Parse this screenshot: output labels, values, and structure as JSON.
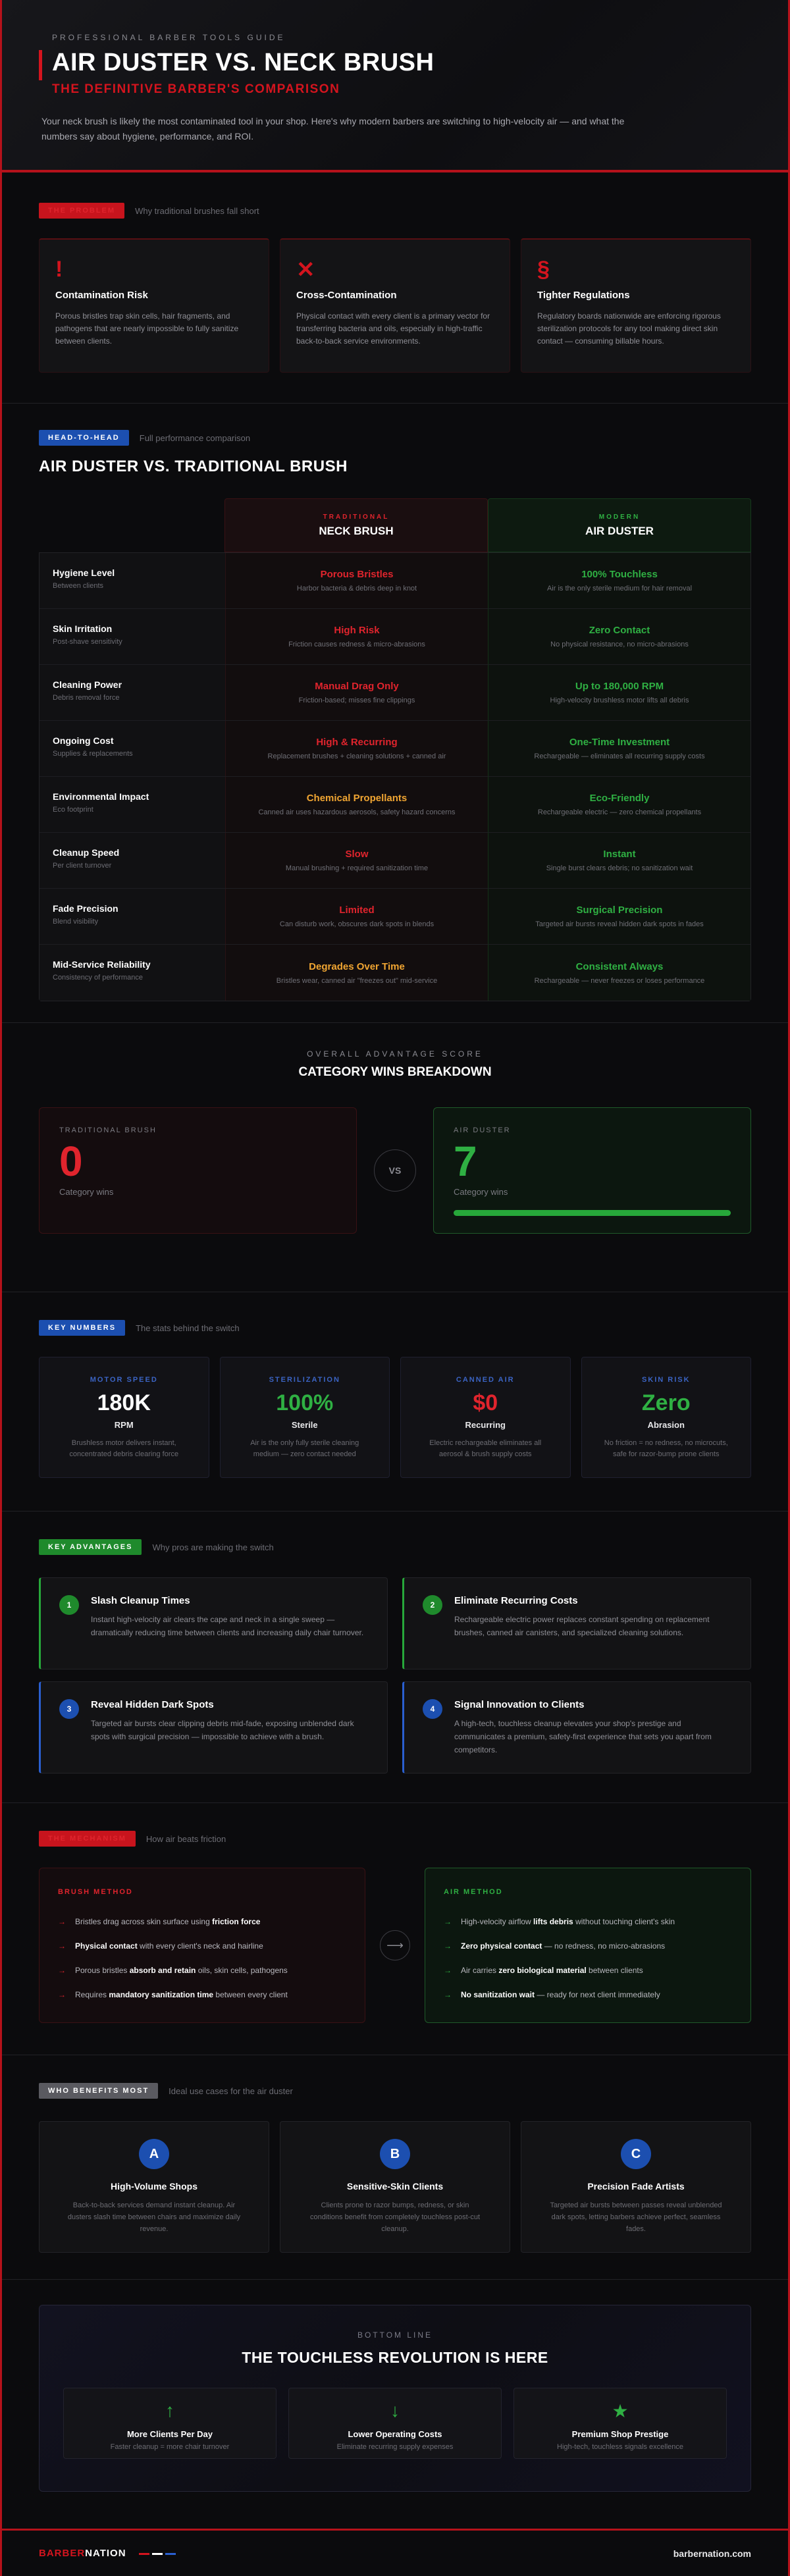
{
  "header": {
    "eyebrow": "PROFESSIONAL BARBER TOOLS GUIDE",
    "title": "AIR DUSTER VS. NECK BRUSH",
    "subtitle": "THE DEFINITIVE BARBER'S COMPARISON",
    "intro": "Your neck brush is likely the most contaminated tool in your shop. Here's why modern barbers are switching to high-velocity air — and what the numbers say about hygiene, performance, and ROI."
  },
  "problem": {
    "tag": "THE PROBLEM",
    "note": "Why traditional brushes fall short",
    "cards": [
      {
        "icon": "!",
        "title": "Contamination Risk",
        "text": "Porous bristles trap skin cells, hair fragments, and pathogens that are nearly impossible to fully sanitize between clients."
      },
      {
        "icon": "✕",
        "title": "Cross-Contamination",
        "text": "Physical contact with every client is a primary vector for transferring bacteria and oils, especially in high-traffic back-to-back service environments."
      },
      {
        "icon": "§",
        "title": "Tighter Regulations",
        "text": "Regulatory boards nationwide are enforcing rigorous sterilization protocols for any tool making direct skin contact — consuming billable hours."
      }
    ]
  },
  "compare": {
    "tag": "HEAD-TO-HEAD",
    "note": "Full performance comparison",
    "title": "AIR DUSTER VS. TRADITIONAL BRUSH",
    "trad_kicker": "TRADITIONAL",
    "trad_name": "NECK BRUSH",
    "air_kicker": "MODERN",
    "air_name": "AIR DUSTER",
    "rows": [
      {
        "label": "Hygiene Level",
        "sub": "Between clients",
        "t": "Porous Bristles",
        "td": "Harbor bacteria & debris deep in knot",
        "tc": "red",
        "a": "100% Touchless",
        "ad": "Air is the only sterile medium for hair removal"
      },
      {
        "label": "Skin Irritation",
        "sub": "Post-shave sensitivity",
        "t": "High Risk",
        "td": "Friction causes redness & micro-abrasions",
        "tc": "red",
        "a": "Zero Contact",
        "ad": "No physical resistance, no micro-abrasions"
      },
      {
        "label": "Cleaning Power",
        "sub": "Debris removal force",
        "t": "Manual Drag Only",
        "td": "Friction-based; misses fine clippings",
        "tc": "red",
        "a": "Up to 180,000 RPM",
        "ad": "High-velocity brushless motor lifts all debris"
      },
      {
        "label": "Ongoing Cost",
        "sub": "Supplies & replacements",
        "t": "High & Recurring",
        "td": "Replacement brushes + cleaning solutions + canned air",
        "tc": "red",
        "a": "One-Time Investment",
        "ad": "Rechargeable — eliminates all recurring supply costs"
      },
      {
        "label": "Environmental Impact",
        "sub": "Eco footprint",
        "t": "Chemical Propellants",
        "td": "Canned air uses hazardous aerosols, safety hazard concerns",
        "tc": "org",
        "a": "Eco-Friendly",
        "ad": "Rechargeable electric — zero chemical propellants"
      },
      {
        "label": "Cleanup Speed",
        "sub": "Per client turnover",
        "t": "Slow",
        "td": "Manual brushing + required sanitization time",
        "tc": "red",
        "a": "Instant",
        "ad": "Single burst clears debris; no sanitization wait"
      },
      {
        "label": "Fade Precision",
        "sub": "Blend visibility",
        "t": "Limited",
        "td": "Can disturb work, obscures dark spots in blends",
        "tc": "red",
        "a": "Surgical Precision",
        "ad": "Targeted air bursts reveal hidden dark spots in fades"
      },
      {
        "label": "Mid-Service Reliability",
        "sub": "Consistency of performance",
        "t": "Degrades Over Time",
        "td": "Bristles wear, canned air \"freezes out\" mid-service",
        "tc": "org",
        "a": "Consistent Always",
        "ad": "Rechargeable — never freezes or loses performance"
      }
    ]
  },
  "score": {
    "eyebrow": "OVERALL ADVANTAGE SCORE",
    "title": "CATEGORY WINS BREAKDOWN",
    "trad_label": "TRADITIONAL BRUSH",
    "trad_value": "0",
    "trad_caption": "Category wins",
    "vs": "VS",
    "air_label": "AIR DUSTER",
    "air_value": "7",
    "air_caption": "Category wins",
    "air_fill": 1.0
  },
  "numbers": {
    "tag": "KEY NUMBERS",
    "note": "The stats behind the switch",
    "stats": [
      {
        "k": "MOTOR SPEED",
        "v": "180K",
        "u": "RPM",
        "d": "Brushless motor delivers instant, concentrated debris clearing force",
        "color": "#ffffff"
      },
      {
        "k": "STERILIZATION",
        "v": "100%",
        "u": "Sterile",
        "d": "Air is the only fully sterile cleaning medium — zero contact needed",
        "color": "#2fb043"
      },
      {
        "k": "CANNED AIR",
        "v": "$0",
        "u": "Recurring",
        "d": "Electric rechargeable eliminates all aerosol & brush supply costs",
        "color": "#e0242d"
      },
      {
        "k": "SKIN RISK",
        "v": "Zero",
        "u": "Abrasion",
        "d": "No friction = no redness, no microcuts, safe for razor-bump prone clients",
        "color": "#2fb043"
      }
    ]
  },
  "advantages": {
    "tag": "KEY ADVANTAGES",
    "note": "Why pros are making the switch",
    "items": [
      {
        "n": "1",
        "title": "Slash Cleanup Times",
        "text": "Instant high-velocity air clears the cape and neck in a single sweep — dramatically reducing time between clients and increasing daily chair turnover."
      },
      {
        "n": "2",
        "title": "Eliminate Recurring Costs",
        "text": "Rechargeable electric power replaces constant spending on replacement brushes, canned air canisters, and specialized cleaning solutions."
      },
      {
        "n": "3",
        "title": "Reveal Hidden Dark Spots",
        "text": "Targeted air bursts clear clipping debris mid-fade, exposing unblended dark spots with surgical precision — impossible to achieve with a brush."
      },
      {
        "n": "4",
        "title": "Signal Innovation to Clients",
        "text": "A high-tech, touchless cleanup elevates your shop's prestige and communicates a premium, safety-first experience that sets you apart from competitors."
      }
    ]
  },
  "mechanism": {
    "tag": "THE MECHANISM",
    "note": "How air beats friction",
    "brush_label": "BRUSH METHOD",
    "brush_items": [
      {
        "pre": "Bristles drag across skin surface using ",
        "b": "friction force",
        "post": ""
      },
      {
        "pre": "",
        "b": "Physical contact",
        "post": " with every client's neck and hairline"
      },
      {
        "pre": "Porous bristles ",
        "b": "absorb and retain",
        "post": " oils, skin cells, pathogens"
      },
      {
        "pre": "Requires ",
        "b": "mandatory sanitization time",
        "post": " between every client"
      }
    ],
    "air_label": "AIR METHOD",
    "air_items": [
      {
        "pre": "High-velocity airflow ",
        "b": "lifts debris",
        "post": " without touching client's skin"
      },
      {
        "pre": "",
        "b": "Zero physical contact",
        "post": " — no redness, no micro-abrasions"
      },
      {
        "pre": "Air carries ",
        "b": "zero biological material",
        "post": " between clients"
      },
      {
        "pre": "",
        "b": "No sanitization wait",
        "post": " — ready for next client immediately"
      }
    ]
  },
  "who": {
    "tag": "WHO BENEFITS MOST",
    "note": "Ideal use cases for the air duster",
    "items": [
      {
        "l": "A",
        "title": "High-Volume Shops",
        "text": "Back-to-back services demand instant cleanup. Air dusters slash time between chairs and maximize daily revenue."
      },
      {
        "l": "B",
        "title": "Sensitive-Skin Clients",
        "text": "Clients prone to razor bumps, redness, or skin conditions benefit from completely touchless post-cut cleanup."
      },
      {
        "l": "C",
        "title": "Precision Fade Artists",
        "text": "Targeted air bursts between passes reveal unblended dark spots, letting barbers achieve perfect, seamless fades."
      }
    ]
  },
  "bottom": {
    "eyebrow": "BOTTOM LINE",
    "title": "THE TOUCHLESS REVOLUTION IS HERE",
    "items": [
      {
        "g": "↑",
        "title": "More Clients Per Day",
        "text": "Faster cleanup = more chair turnover",
        "color": "#2fb043"
      },
      {
        "g": "↓",
        "title": "Lower Operating Costs",
        "text": "Eliminate recurring supply expenses",
        "color": "#2fb043"
      },
      {
        "g": "★",
        "title": "Premium Shop Prestige",
        "text": "High-tech, touchless signals excellence",
        "color": "#2fb043"
      }
    ]
  },
  "footer": {
    "brand1": "BARBER",
    "brand2": "NATION",
    "url": "barbernation.com"
  }
}
